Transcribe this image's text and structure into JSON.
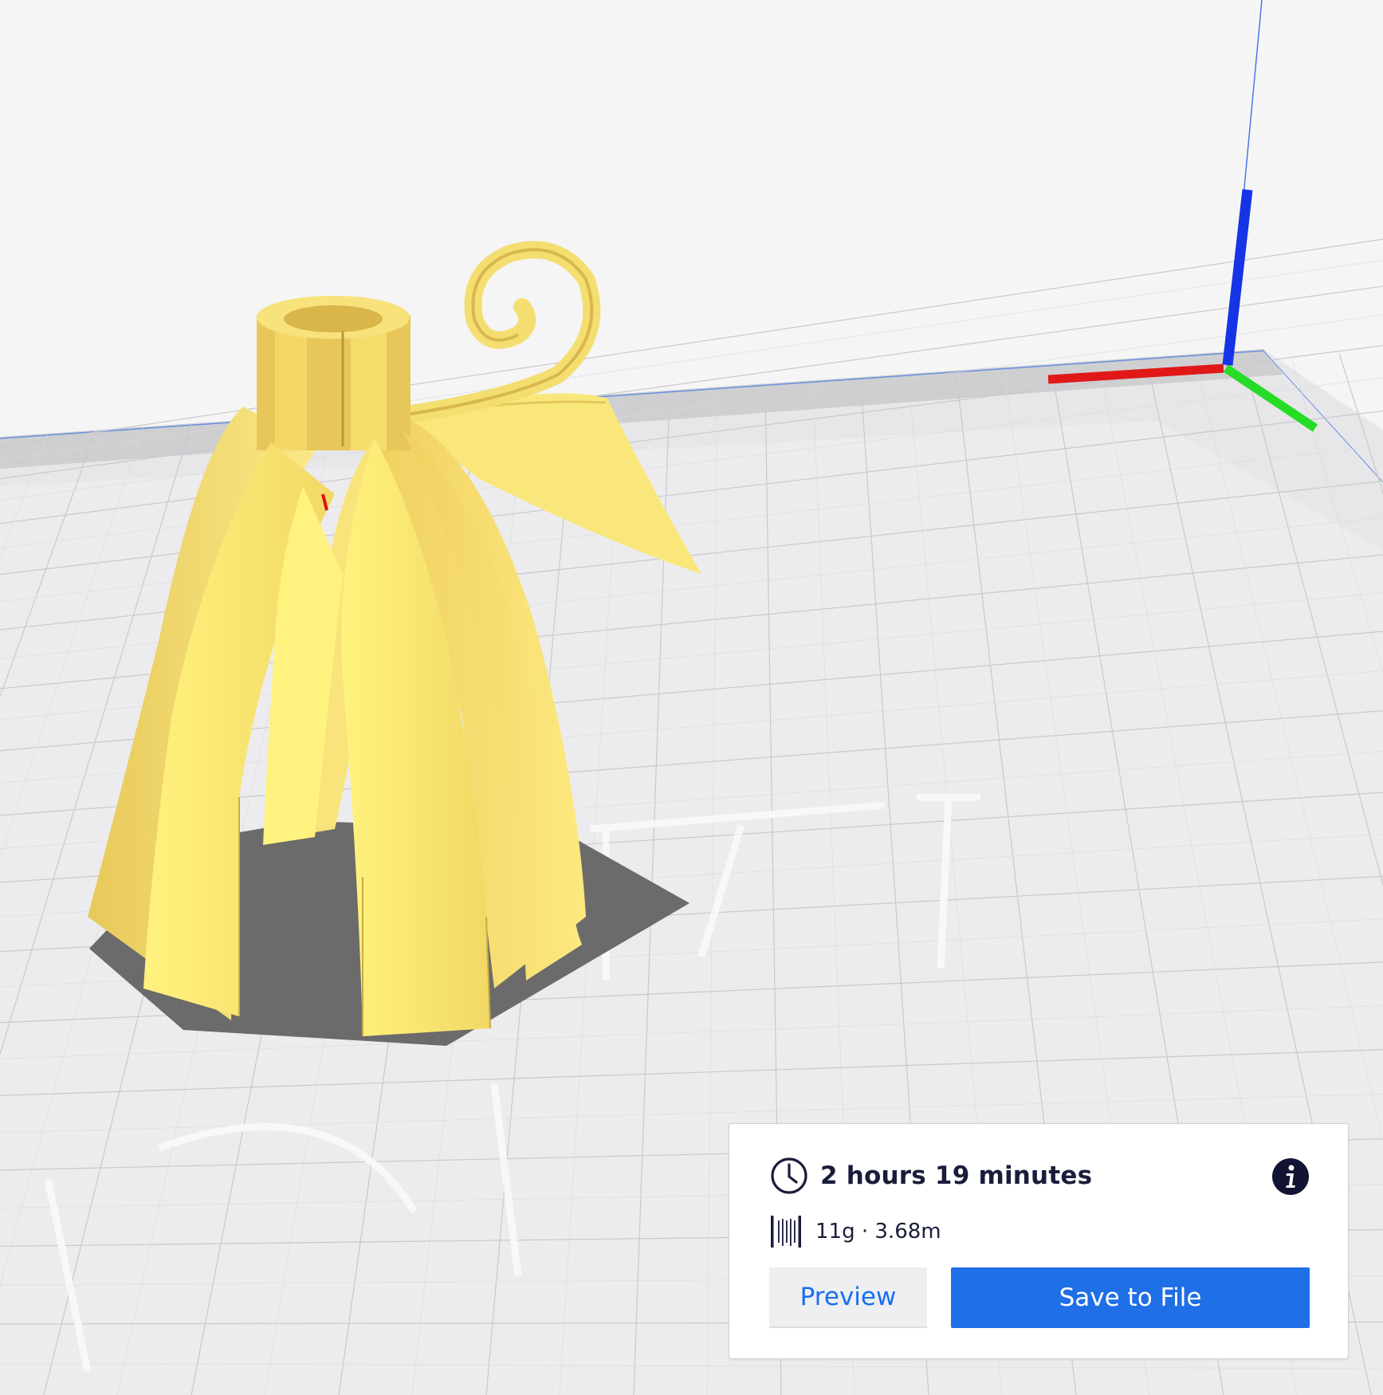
{
  "print_summary": {
    "print_time": "2 hours 19 minutes",
    "material": "11g · 3.68m"
  },
  "actions": {
    "preview_label": "Preview",
    "save_label": "Save to File"
  },
  "colors": {
    "model": "#f5e27a",
    "accent": "#1f6fe6",
    "axis_x": "#e01010",
    "axis_y": "#20d020",
    "axis_z": "#1030e0"
  },
  "icons": {
    "time": "clock-icon",
    "material": "spool-icon",
    "info": "info-icon"
  }
}
